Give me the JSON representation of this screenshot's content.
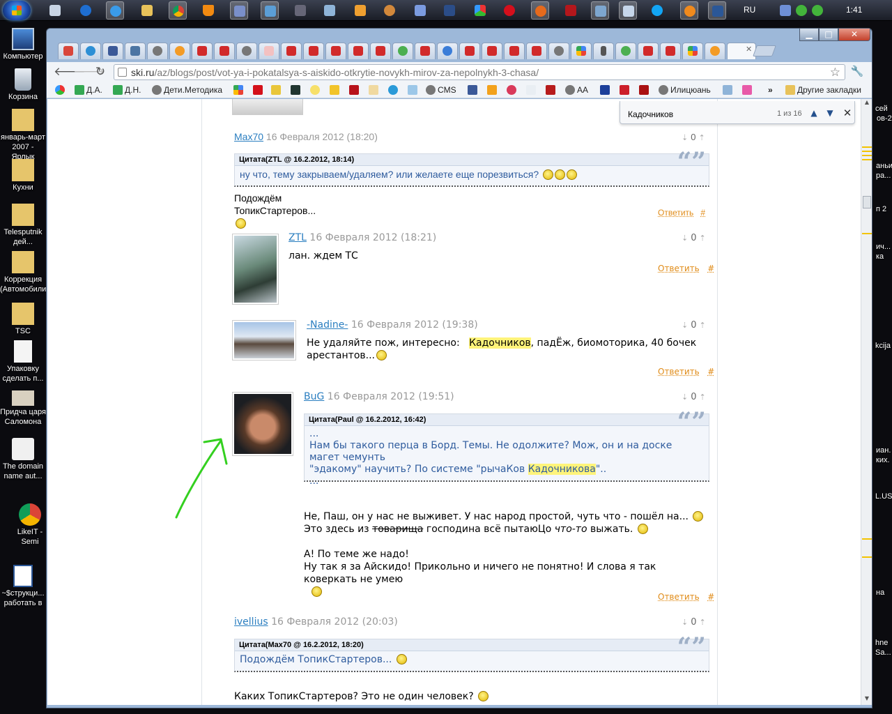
{
  "taskbar": {
    "lang": "RU",
    "clock": "1:41"
  },
  "desktop": {
    "icons": [
      "Компьютер",
      "Корзина",
      "январь-март 2007 - Ярлык",
      "Кухни",
      "Telesputnik дей...",
      "Коррекция (Автомобили)",
      "TSC",
      "Упаковку сделать п...",
      "Придча царя Саломона",
      "The domain name aut...",
      "LikeIT - Semi",
      "~$струкци... работать в"
    ],
    "right_fragments": [
      "сей",
      "ов-2",
      "аньи",
      "ра...",
      "п 2",
      "ич...",
      "ка",
      "kcija",
      "иан.",
      "ких.",
      "L.US",
      "на",
      "hne",
      "Sa..."
    ]
  },
  "browser": {
    "url_host": "ski.ru",
    "url_path": "/az/blogs/post/vot-ya-i-pokatalsya-s-aiskido-otkrytie-novykh-mirov-za-nepolnykh-3-chasa/",
    "bookmarks": [
      "Д.А.",
      "Д.Н.",
      "Дети.Методика",
      "CMS",
      "AA",
      "Илицюань",
      "Другие закладки"
    ],
    "find": {
      "query": "Кадочников",
      "count": "1 из 16"
    }
  },
  "comments": [
    {
      "author": "Max70",
      "date": "16 Февраля 2012 (18:20)",
      "votes": "0",
      "quote_head": "Цитата(ZTL @ 16.2.2012, 18:14)",
      "quote_body": "ну что, тему закрываем/удаляем? или желаете еще порезвиться?",
      "text": "Подождём ТопикСтартеров...",
      "reply": "Ответить",
      "hash": "#"
    },
    {
      "author": "ZTL",
      "date": "16 Февраля 2012 (18:21)",
      "votes": "0",
      "text": "лан. ждем ТС",
      "reply": "Ответить",
      "hash": "#"
    },
    {
      "author": "-Nadine-",
      "date": "16 Февраля 2012 (19:38)",
      "votes": "0",
      "text_a": "Не удаляйте пож, интересно: ",
      "hl": "Кадочников",
      "text_b": ", падЁж, биомоторика, 40 бочек",
      "text_c": "арестантов...",
      "reply": "Ответить",
      "hash": "#"
    },
    {
      "author": "BuG",
      "date": "16 Февраля 2012 (19:51)",
      "votes": "0",
      "quote_head": "Цитата(Paul @ 16.2.2012, 16:42)",
      "q1": "...",
      "q2": "Нам бы такого перца в Борд. Темы. Не одолжите? Мож, он и на доске магет чемунть",
      "q3a": "\"эдакому\" научить? По системе \"рычаКов ",
      "q3hl": "Кадочникова",
      "q3b": "\"..",
      "q4": "...",
      "l1": "Не, Паш, он у нас не выживет. У нас народ простой, чуть что - пошёл на...",
      "l2a": "Это здесь из ",
      "l2s": "товарища",
      "l2b": " господина всё пытаюЦо ",
      "l2i": "что-то",
      "l2c": " выжать.",
      "l3": "А! По теме же надо!",
      "l4": "Ну так я за Айскидо! Прикольно и ничего не понятно! И слова я так коверкать не умею",
      "reply": "Ответить",
      "hash": "#"
    },
    {
      "author": "ivellius",
      "date": "16 Февраля 2012 (20:03)",
      "votes": "0",
      "quote_head": "Цитата(Max70 @ 16.2.2012, 18:20)",
      "quote_body": "Подождём ТопикСтартеров...",
      "text": "Каких ТопикСтартеров? Это не один человек?"
    }
  ]
}
